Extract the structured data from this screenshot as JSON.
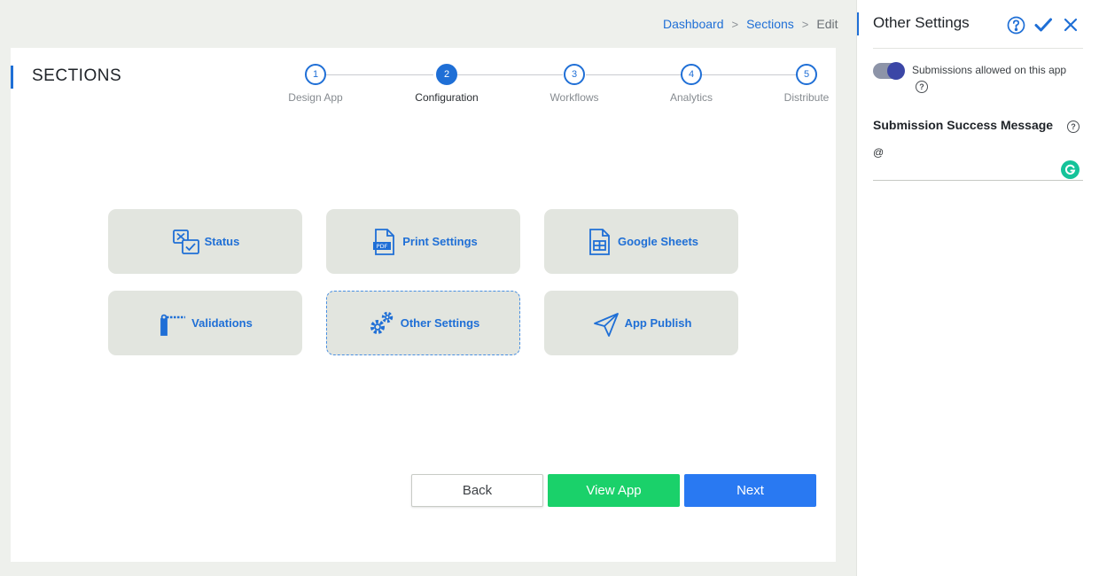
{
  "breadcrumb": {
    "items": [
      "Dashboard",
      "Sections",
      "Edit"
    ],
    "separator": ">"
  },
  "page": {
    "title": "SECTIONS"
  },
  "stepper": {
    "active_step": 2,
    "steps": [
      {
        "number": "1",
        "label": "Design App"
      },
      {
        "number": "2",
        "label": "Configuration"
      },
      {
        "number": "3",
        "label": "Workflows"
      },
      {
        "number": "4",
        "label": "Analytics"
      },
      {
        "number": "5",
        "label": "Distribute"
      }
    ]
  },
  "tiles": [
    {
      "label": "Status",
      "icon": "status-icon"
    },
    {
      "label": "Print Settings",
      "icon": "pdf-icon"
    },
    {
      "label": "Google Sheets",
      "icon": "sheet-icon"
    },
    {
      "label": "Validations",
      "icon": "barrier-icon"
    },
    {
      "label": "Other Settings",
      "icon": "gears-icon",
      "selected": true
    },
    {
      "label": "App Publish",
      "icon": "send-icon"
    }
  ],
  "buttons": {
    "back": "Back",
    "view_app": "View App",
    "next": "Next"
  },
  "panel": {
    "title": "Other Settings",
    "toggle": {
      "label": "Submissions allowed on this app",
      "on": true
    },
    "success_message": {
      "label": "Submission Success Message",
      "value": "@"
    }
  },
  "colors": {
    "accent": "#1f6fd6",
    "tile_bg": "#e2e5df",
    "view_button": "#1ad16a",
    "next_button": "#2979f2",
    "toggle_knob": "#3b46a6"
  }
}
